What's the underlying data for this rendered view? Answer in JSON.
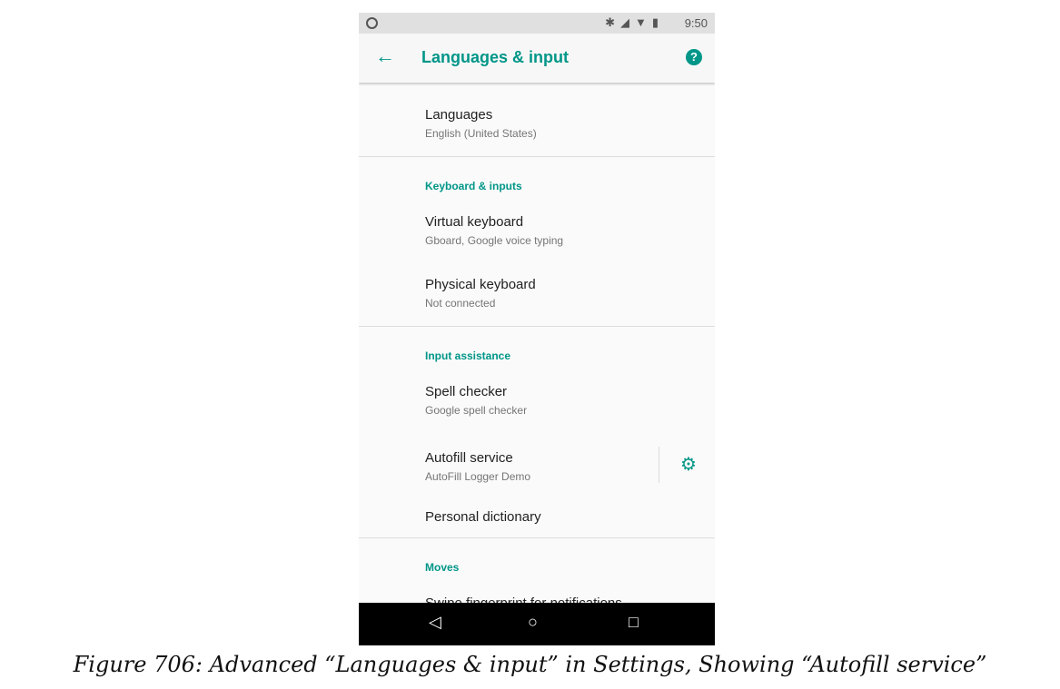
{
  "status_bar": {
    "time": "9:50"
  },
  "app_bar": {
    "title": "Languages & input"
  },
  "items": {
    "languages": {
      "title": "Languages",
      "subtitle": "English (United States)"
    },
    "keyboard_header": "Keyboard & inputs",
    "virtual_keyboard": {
      "title": "Virtual keyboard",
      "subtitle": "Gboard, Google voice typing"
    },
    "physical_keyboard": {
      "title": "Physical keyboard",
      "subtitle": "Not connected"
    },
    "assist_header": "Input assistance",
    "spell_checker": {
      "title": "Spell checker",
      "subtitle": "Google spell checker"
    },
    "autofill": {
      "title": "Autofill service",
      "subtitle": "AutoFill Logger Demo"
    },
    "personal_dictionary": {
      "title": "Personal dictionary"
    },
    "moves_header": "Moves",
    "swipe": {
      "title": "Swipe fingerprint for notifications"
    }
  },
  "caption": "Figure 706: Advanced “Languages & input” in Settings, Showing “Autofill service”",
  "colors": {
    "accent": "#009688",
    "background": "#fafafa",
    "navbar": "#000000"
  },
  "icons": [
    "back-arrow-icon",
    "help-icon",
    "gear-icon",
    "nav-back-icon",
    "nav-home-icon",
    "nav-recents-icon"
  ]
}
